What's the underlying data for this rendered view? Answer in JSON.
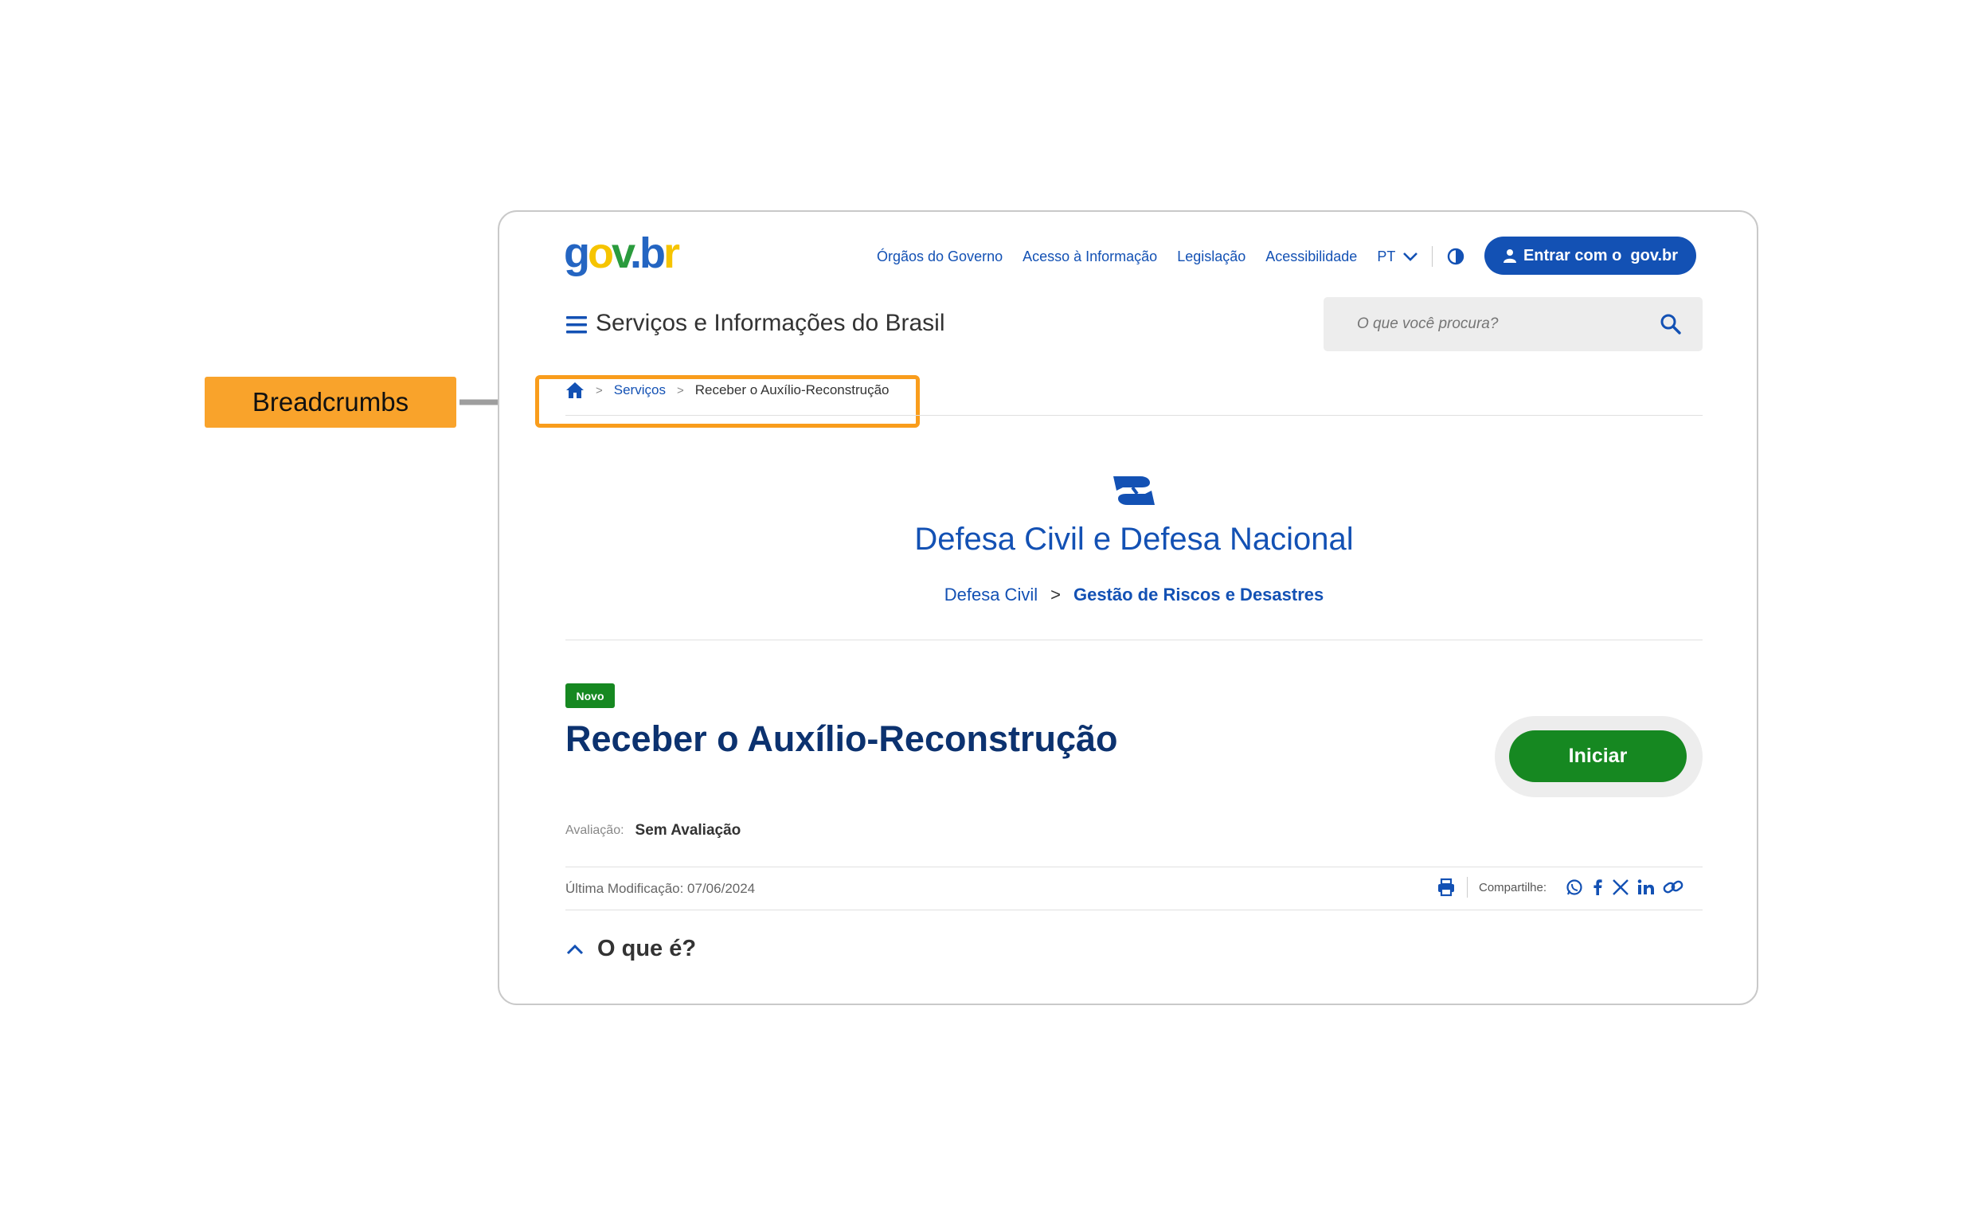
{
  "annotation": {
    "callout_label": "Breadcrumbs"
  },
  "header": {
    "logo": {
      "g": "g",
      "o": "o",
      "v": "v",
      "dot": ".",
      "b": "b",
      "r": "r"
    },
    "links": [
      "Órgãos do Governo",
      "Acesso à Informação",
      "Legislação",
      "Acessibilidade"
    ],
    "language": "PT",
    "login_label": "Entrar com o  gov.br",
    "site_title": "Serviços e Informações do Brasil",
    "search_placeholder": "O que você procura?"
  },
  "breadcrumb": {
    "sep": ">",
    "items": [
      "Serviços",
      "Receber o Auxílio-Reconstrução"
    ]
  },
  "organization": {
    "title": "Defesa Civil e Defesa Nacional",
    "category": "Defesa Civil",
    "separator": ">",
    "subcategory": "Gestão de Riscos e Desastres"
  },
  "service": {
    "badge": "Novo",
    "title": "Receber o Auxílio-Reconstrução",
    "start_label": "Iniciar",
    "rating_label": "Avaliação:",
    "rating_value": "Sem Avaliação",
    "last_modified": "Última Modificação: 07/06/2024",
    "share_label": "Compartilhe:",
    "section_title": "O que é?"
  },
  "colors": {
    "primary_blue": "#1351b4",
    "dark_blue": "#0c326f",
    "green": "#168821",
    "annotation_orange": "#f9a32b"
  }
}
